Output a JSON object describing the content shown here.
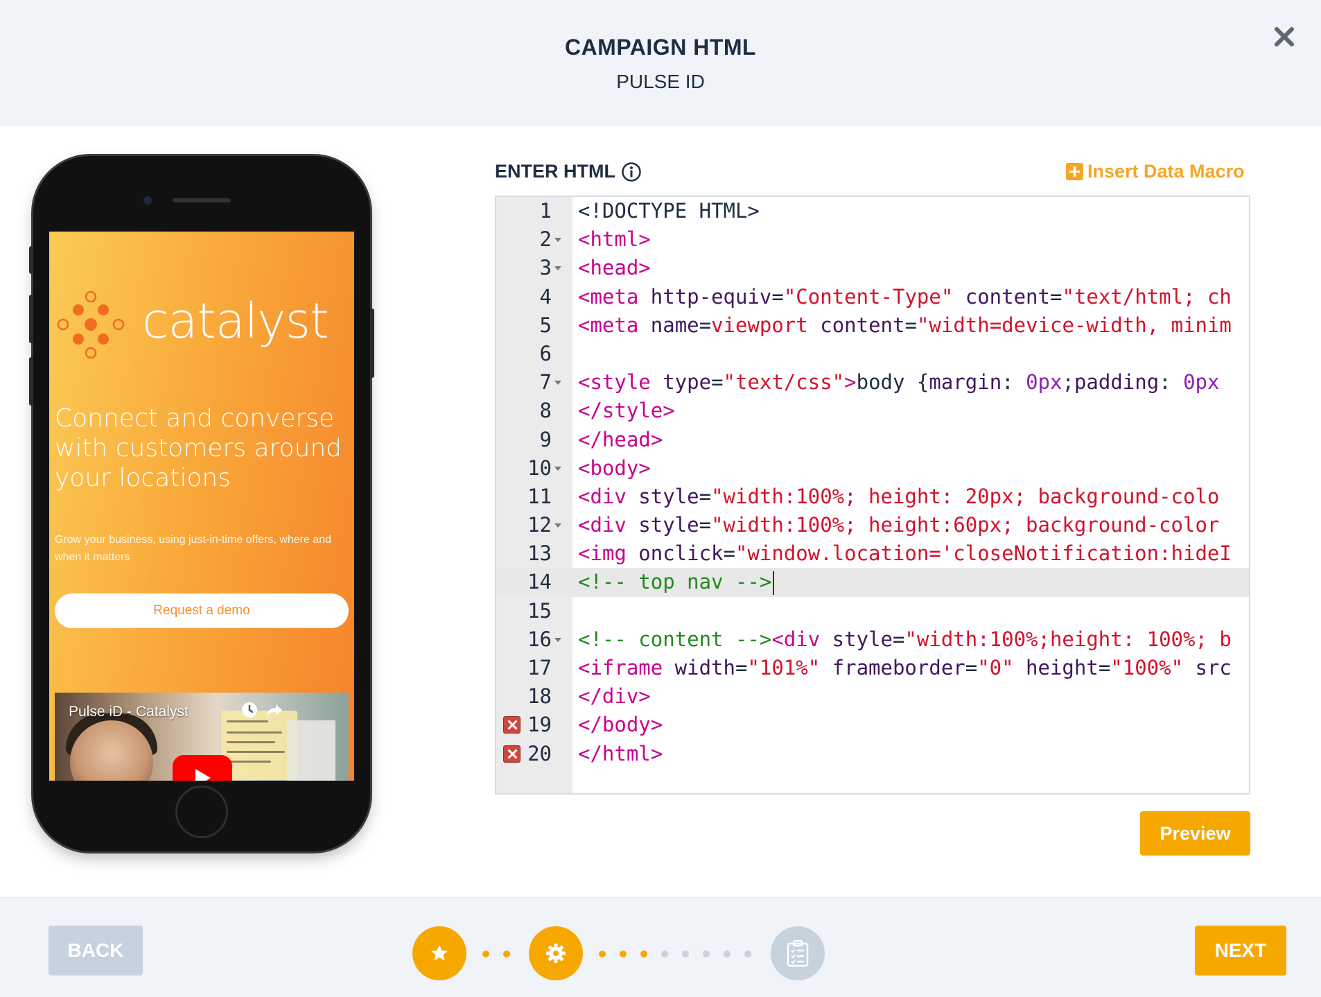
{
  "header": {
    "title": "CAMPAIGN HTML",
    "subtitle": "PULSE ID",
    "close_icon": "close-icon"
  },
  "preview": {
    "brand": "catalyst",
    "headline": "Connect and converse with customers around your locations",
    "subline": "Grow your business, using just-in-time offers, where and when it matters",
    "demo_button": "Request a demo",
    "video_title": "Pulse iD - Catalyst"
  },
  "editor": {
    "label": "ENTER HTML",
    "info_icon": "info-icon",
    "macro_link": "Insert Data Macro",
    "active_line": 14,
    "lines": [
      {
        "num": "1",
        "fold": false,
        "error": false,
        "tokens": [
          {
            "c": "t-txt",
            "t": "<!DOCTYPE HTML>"
          }
        ]
      },
      {
        "num": "2",
        "fold": true,
        "error": false,
        "tokens": [
          {
            "c": "t-tag",
            "t": "<html>"
          }
        ]
      },
      {
        "num": "3",
        "fold": true,
        "error": false,
        "tokens": [
          {
            "c": "t-tag",
            "t": "<head>"
          }
        ]
      },
      {
        "num": "4",
        "fold": false,
        "error": false,
        "tokens": [
          {
            "c": "t-tag",
            "t": "<meta"
          },
          {
            "c": "t-attr",
            "t": " http-equiv"
          },
          {
            "c": "t-txt",
            "t": "="
          },
          {
            "c": "t-str",
            "t": "\"Content-Type\""
          },
          {
            "c": "t-attr",
            "t": " content"
          },
          {
            "c": "t-txt",
            "t": "="
          },
          {
            "c": "t-str",
            "t": "\"text/html; ch"
          }
        ]
      },
      {
        "num": "5",
        "fold": false,
        "error": false,
        "tokens": [
          {
            "c": "t-tag",
            "t": "<meta"
          },
          {
            "c": "t-attr",
            "t": " name"
          },
          {
            "c": "t-txt",
            "t": "="
          },
          {
            "c": "t-str",
            "t": "viewport"
          },
          {
            "c": "t-attr",
            "t": " content"
          },
          {
            "c": "t-txt",
            "t": "="
          },
          {
            "c": "t-str",
            "t": "\"width=device-width, minim"
          }
        ]
      },
      {
        "num": "6",
        "fold": false,
        "error": false,
        "tokens": []
      },
      {
        "num": "7",
        "fold": true,
        "error": false,
        "tokens": [
          {
            "c": "t-tag",
            "t": "<style"
          },
          {
            "c": "t-attr",
            "t": " type"
          },
          {
            "c": "t-txt",
            "t": "="
          },
          {
            "c": "t-str",
            "t": "\"text/css\""
          },
          {
            "c": "t-tag",
            "t": ">"
          },
          {
            "c": "t-txt",
            "t": "body {"
          },
          {
            "c": "t-attr",
            "t": "margin"
          },
          {
            "c": "t-txt",
            "t": ": "
          },
          {
            "c": "t-num",
            "t": "0px"
          },
          {
            "c": "t-txt",
            "t": ";"
          },
          {
            "c": "t-attr",
            "t": "padding"
          },
          {
            "c": "t-txt",
            "t": ": "
          },
          {
            "c": "t-num",
            "t": "0px"
          }
        ]
      },
      {
        "num": "8",
        "fold": false,
        "error": false,
        "tokens": [
          {
            "c": "t-tag",
            "t": "</style>"
          }
        ]
      },
      {
        "num": "9",
        "fold": false,
        "error": false,
        "tokens": [
          {
            "c": "t-tag",
            "t": "</head>"
          }
        ]
      },
      {
        "num": "10",
        "fold": true,
        "error": false,
        "tokens": [
          {
            "c": "t-tag",
            "t": "<body>"
          }
        ]
      },
      {
        "num": "11",
        "fold": false,
        "error": false,
        "tokens": [
          {
            "c": "t-tag",
            "t": "<div"
          },
          {
            "c": "t-attr",
            "t": " style"
          },
          {
            "c": "t-txt",
            "t": "="
          },
          {
            "c": "t-str",
            "t": "\"width:100%; height: 20px; background-colo"
          }
        ]
      },
      {
        "num": "12",
        "fold": true,
        "error": false,
        "tokens": [
          {
            "c": "t-tag",
            "t": "<div"
          },
          {
            "c": "t-attr",
            "t": " style"
          },
          {
            "c": "t-txt",
            "t": "="
          },
          {
            "c": "t-str",
            "t": "\"width:100%; height:60px; background-color"
          }
        ]
      },
      {
        "num": "13",
        "fold": false,
        "error": false,
        "tokens": [
          {
            "c": "t-tag",
            "t": "<img"
          },
          {
            "c": "t-attr",
            "t": " onclick"
          },
          {
            "c": "t-txt",
            "t": "="
          },
          {
            "c": "t-str",
            "t": "\"window.location='closeNotification:hideI"
          }
        ]
      },
      {
        "num": "14",
        "fold": false,
        "error": false,
        "tokens": [
          {
            "c": "t-com",
            "t": "<!-- top nav -->"
          }
        ]
      },
      {
        "num": "15",
        "fold": false,
        "error": false,
        "tokens": []
      },
      {
        "num": "16",
        "fold": true,
        "error": false,
        "tokens": [
          {
            "c": "t-com",
            "t": "<!-- content -->"
          },
          {
            "c": "t-tag",
            "t": "<div"
          },
          {
            "c": "t-attr",
            "t": " style"
          },
          {
            "c": "t-txt",
            "t": "="
          },
          {
            "c": "t-str",
            "t": "\"width:100%;height: 100%; b"
          }
        ]
      },
      {
        "num": "17",
        "fold": false,
        "error": false,
        "tokens": [
          {
            "c": "t-tag",
            "t": "<iframe"
          },
          {
            "c": "t-attr",
            "t": " width"
          },
          {
            "c": "t-txt",
            "t": "="
          },
          {
            "c": "t-str",
            "t": "\"101%\""
          },
          {
            "c": "t-attr",
            "t": " frameborder"
          },
          {
            "c": "t-txt",
            "t": "="
          },
          {
            "c": "t-str",
            "t": "\"0\""
          },
          {
            "c": "t-attr",
            "t": " height"
          },
          {
            "c": "t-txt",
            "t": "="
          },
          {
            "c": "t-str",
            "t": "\"100%\""
          },
          {
            "c": "t-attr",
            "t": " src"
          }
        ]
      },
      {
        "num": "18",
        "fold": false,
        "error": false,
        "tokens": [
          {
            "c": "t-tag",
            "t": "</div>"
          }
        ]
      },
      {
        "num": "19",
        "fold": false,
        "error": true,
        "tokens": [
          {
            "c": "t-tag",
            "t": "</body>"
          }
        ]
      },
      {
        "num": "20",
        "fold": false,
        "error": true,
        "tokens": [
          {
            "c": "t-tag",
            "t": "</html>"
          }
        ]
      }
    ]
  },
  "actions": {
    "preview": "Preview",
    "back": "BACK",
    "next": "NEXT"
  },
  "wizard": {
    "steps": [
      {
        "icon": "star-icon",
        "status": "done"
      },
      {
        "icon": "gear-icon",
        "status": "done"
      },
      {
        "icon": "clipboard-checklist-icon",
        "status": "pending"
      }
    ]
  },
  "colors": {
    "accent": "#f7a800",
    "header_bg": "#f0f3f7",
    "muted_button": "#c6d2de",
    "title_text": "#1f2d43"
  }
}
